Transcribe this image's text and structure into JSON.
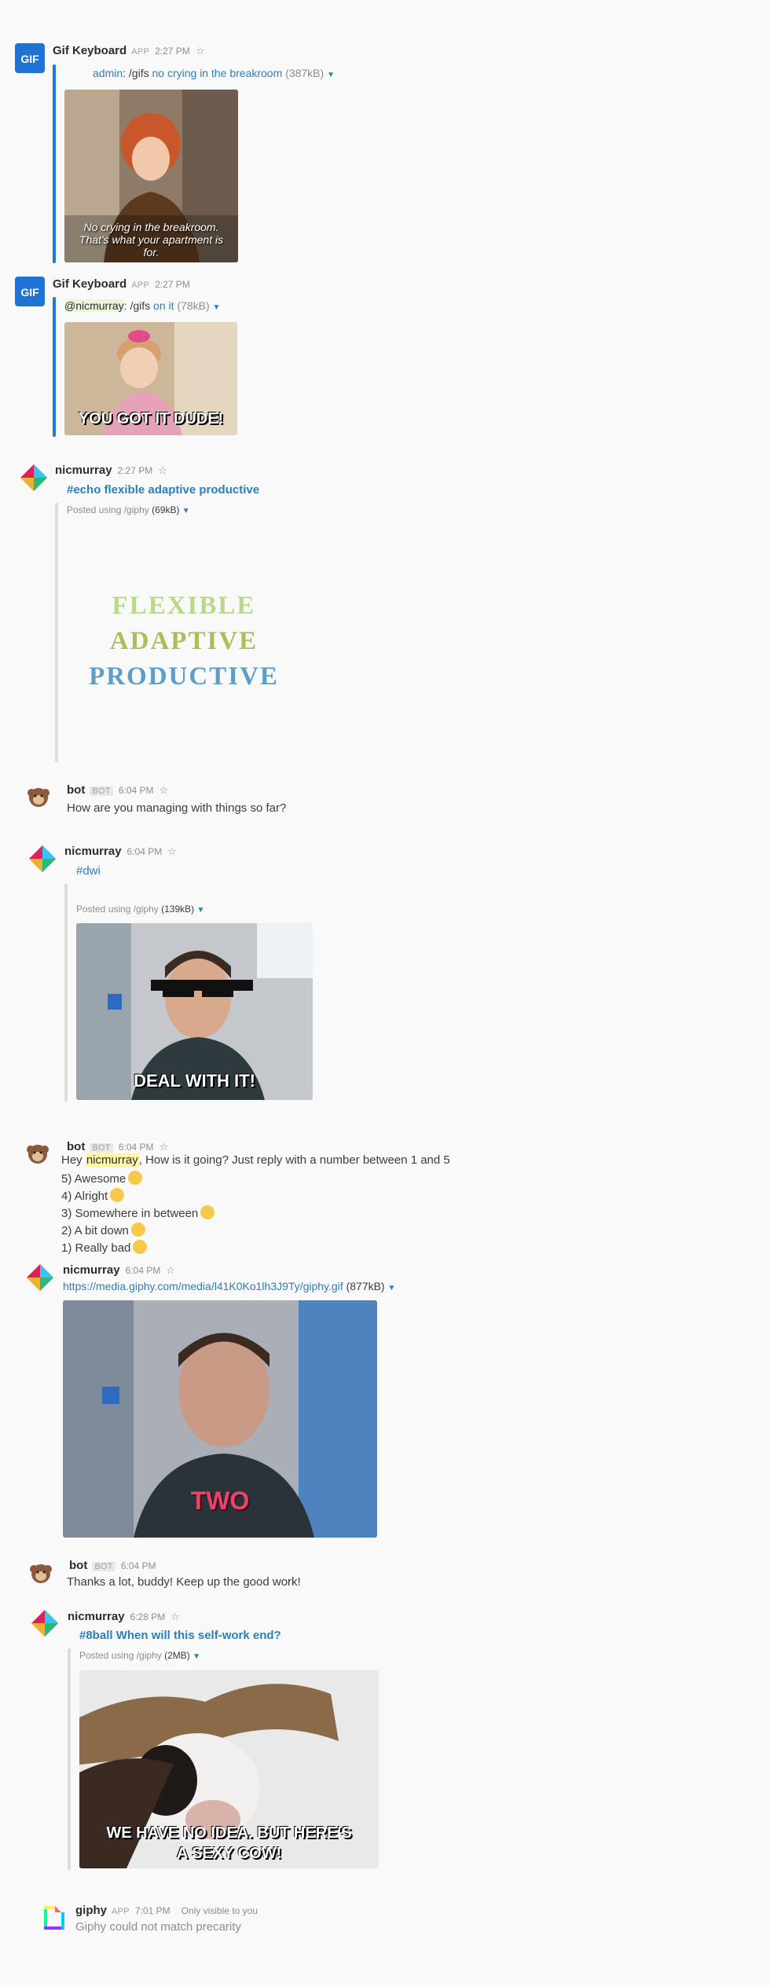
{
  "messages": {
    "m1": {
      "author": "Gif Keyboard",
      "badge": "APP",
      "time": "2:27 PM",
      "user": "admin",
      "command": ": /gifs",
      "query": "no crying in the breakroom",
      "size": "(387kB)",
      "caption": "No crying in the breakroom. That's what your apartment is for."
    },
    "m2": {
      "author": "Gif Keyboard",
      "badge": "APP",
      "time": "2:27 PM",
      "user": "@nicmurray",
      "command": ": /gifs",
      "query": "on it",
      "size": "(78kB)",
      "caption": "YOU GOT IT DUDE!"
    },
    "m3": {
      "author": "nicmurray",
      "time": "2:27 PM",
      "title": "#echo flexible adaptive productive",
      "posted": "Posted using /giphy",
      "size": "(69kB)",
      "gif_lines": [
        "FLEXIBLE",
        "ADAPTIVE",
        "PRODUCTIVE"
      ]
    },
    "m4": {
      "author": "bot",
      "badge": "BOT",
      "time": "6:04 PM",
      "text": "How are you managing with things so far?"
    },
    "m5": {
      "author": "nicmurray",
      "time": "6:04 PM",
      "title": "#dwi",
      "posted": "Posted using /giphy",
      "size": "(139kB)",
      "caption": "DEAL WITH IT!"
    },
    "m6": {
      "author": "bot",
      "badge": "BOT",
      "time": "6:04 PM",
      "line_start": "Hey ",
      "mention": "nicmurray",
      "line_end": ", How is it going? Just reply with a number between 1 and 5",
      "options": [
        "5) Awesome",
        "4) Alright",
        "3) Somewhere in between",
        "2) A bit down",
        "1) Really bad"
      ]
    },
    "m7": {
      "author": "nicmurray",
      "time": "6:04 PM",
      "url": "https://media.giphy.com/media/l41K0Ko1lh3J9Ty/giphy.gif",
      "size": "(877kB)",
      "caption": "TWO"
    },
    "m8": {
      "author": "bot",
      "badge": "BOT",
      "time": "6:04 PM",
      "text": "Thanks a lot, buddy! Keep up the good work!"
    },
    "m9": {
      "author": "nicmurray",
      "time": "6:28 PM",
      "title": "#8ball When will this self-work end?",
      "posted": "Posted using /giphy",
      "size": "(2MB)",
      "caption_1": "WE HAVE NO IDEA. BUT HERE'S",
      "caption_2": "A SEXY COW!"
    },
    "m10": {
      "author": "giphy",
      "badge": "APP",
      "time": "7:01 PM",
      "visibility": "Only visible to you",
      "text": "Giphy could not match precarity"
    }
  },
  "icons": {
    "gif_keyboard_avatar": "gif-keyboard-logo",
    "nicmurray_avatar": "colorful-diamond-avatar",
    "bot_avatar": "monkey-avatar",
    "giphy_avatar": "giphy-logo",
    "star": "☆",
    "caret": "▼"
  },
  "colors": {
    "link": "#2a80b9",
    "app_bar": "#1d7bd4",
    "attachment_bar": "#dcdcdc"
  },
  "avatar_text": {
    "gif_keyboard": "GIF"
  }
}
